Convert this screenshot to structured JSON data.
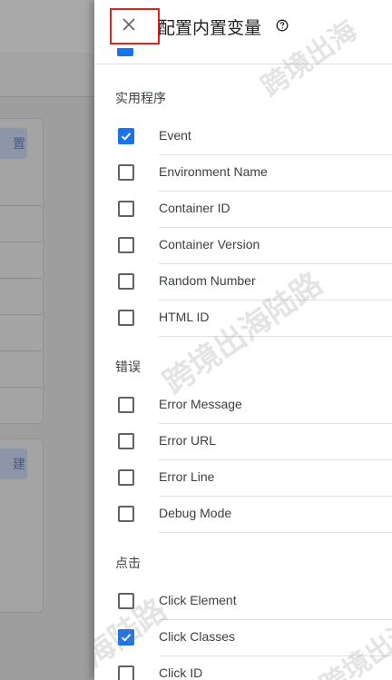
{
  "panel": {
    "title": "配置内置变量",
    "close_icon": "close-icon",
    "help_icon": "help-circle-icon",
    "accent_color": "#1a73e8",
    "highlight_color": "#e2231a"
  },
  "background": {
    "chip_1": "置",
    "chip_2": "建"
  },
  "sections": [
    {
      "title": "实用程序",
      "items": [
        {
          "label": "Event",
          "checked": true
        },
        {
          "label": "Environment Name",
          "checked": false
        },
        {
          "label": "Container ID",
          "checked": false
        },
        {
          "label": "Container Version",
          "checked": false
        },
        {
          "label": "Random Number",
          "checked": false
        },
        {
          "label": "HTML ID",
          "checked": false
        }
      ]
    },
    {
      "title": "错误",
      "items": [
        {
          "label": "Error Message",
          "checked": false
        },
        {
          "label": "Error URL",
          "checked": false
        },
        {
          "label": "Error Line",
          "checked": false
        },
        {
          "label": "Debug Mode",
          "checked": false
        }
      ]
    },
    {
      "title": "点击",
      "items": [
        {
          "label": "Click Element",
          "checked": false
        },
        {
          "label": "Click Classes",
          "checked": true
        },
        {
          "label": "Click ID",
          "checked": false
        }
      ]
    }
  ],
  "watermark": "跨境出海陆路"
}
